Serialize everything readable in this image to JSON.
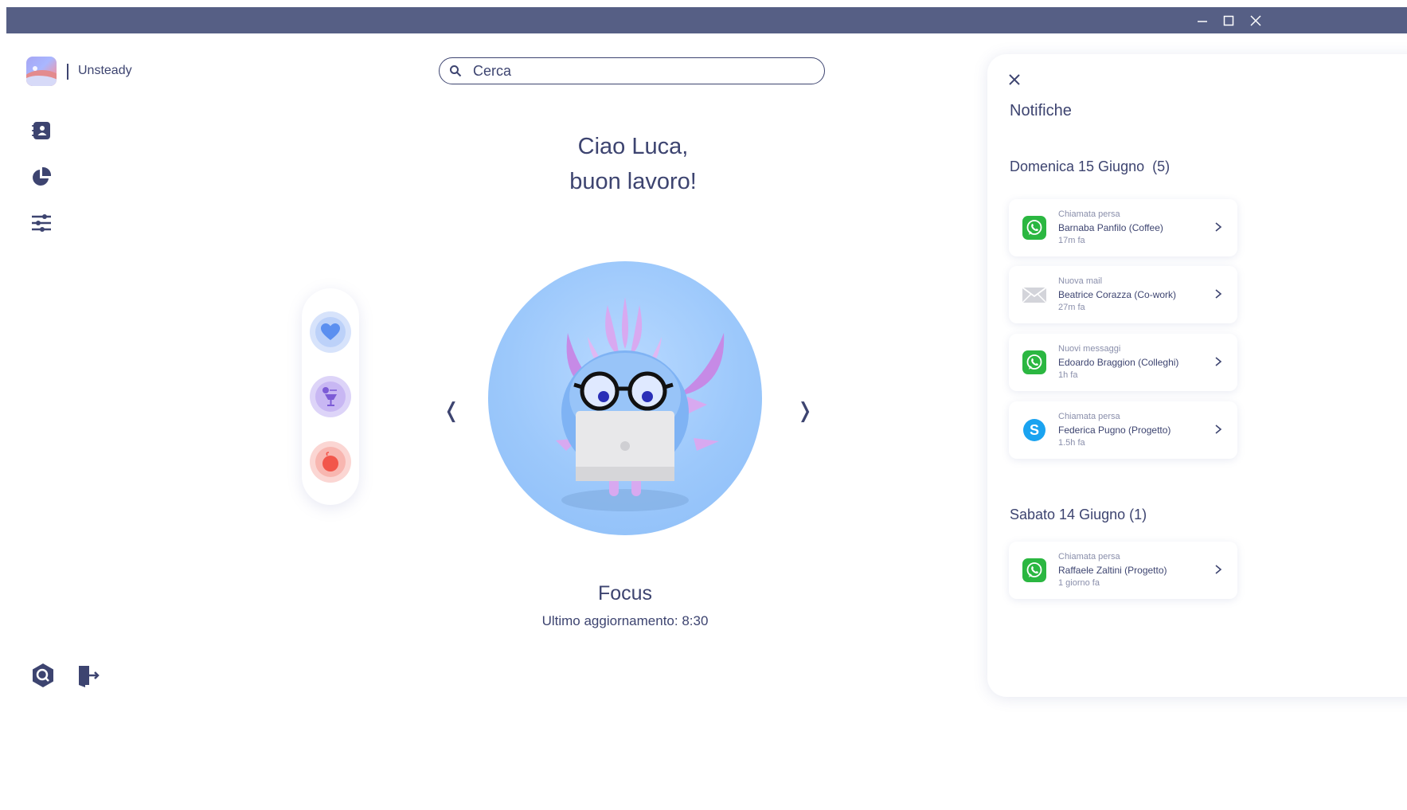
{
  "window": {
    "controls": {
      "minimize_icon": "minimize-icon",
      "maximize_icon": "maximize-icon",
      "close_icon": "close-icon"
    }
  },
  "brand": {
    "name": "Unsteady",
    "logo_icon": "app-logo"
  },
  "sidebar": {
    "items": [
      {
        "icon": "contacts-book-icon"
      },
      {
        "icon": "pie-chart-icon"
      },
      {
        "icon": "sliders-icon"
      }
    ],
    "bottom": [
      {
        "icon": "support-icon"
      },
      {
        "icon": "logout-icon"
      }
    ]
  },
  "search": {
    "placeholder": "Cerca",
    "icon": "search-icon"
  },
  "greeting": {
    "line1": "Ciao Luca,",
    "line2": "buon lavoro!"
  },
  "mood_selector": {
    "items": [
      {
        "icon": "heart-icon",
        "color": "#5b8ff0"
      },
      {
        "icon": "drink-icon",
        "color": "#7c5bd6"
      },
      {
        "icon": "bomb-icon",
        "color": "#f2564b"
      }
    ]
  },
  "carousel": {
    "prev": "❬",
    "next": "❭"
  },
  "status": {
    "title": "Focus",
    "subtitle": "Ultimo aggiornamento: 8:30"
  },
  "notifications": {
    "title": "Notifiche",
    "groups": [
      {
        "title": "Domenica 15 Giugno  (5)",
        "items": [
          {
            "app": "whatsapp-icon",
            "type": "Chiamata persa",
            "from": "Barnaba Panfilo (Coffee)",
            "time": "17m fa"
          },
          {
            "app": "mail-icon",
            "type": "Nuova mail",
            "from": "Beatrice Corazza (Co-work)",
            "time": "27m fa"
          },
          {
            "app": "whatsapp-icon",
            "type": "Nuovi messaggi",
            "from": "Edoardo Braggion (Colleghi)",
            "time": "1h fa"
          },
          {
            "app": "skype-icon",
            "type": "Chiamata persa",
            "from": "Federica Pugno (Progetto)",
            "time": "1.5h fa"
          }
        ]
      },
      {
        "title": "Sabato 14 Giugno (1)",
        "items": [
          {
            "app": "whatsapp-icon",
            "type": "Chiamata persa",
            "from": "Raffaele Zaltini (Progetto)",
            "time": "1 giorno fa"
          }
        ]
      }
    ]
  },
  "colors": {
    "titlebar": "#565f85",
    "text": "#3d4470",
    "whatsapp": "#2bb741",
    "skype": "#1aa3f0"
  }
}
